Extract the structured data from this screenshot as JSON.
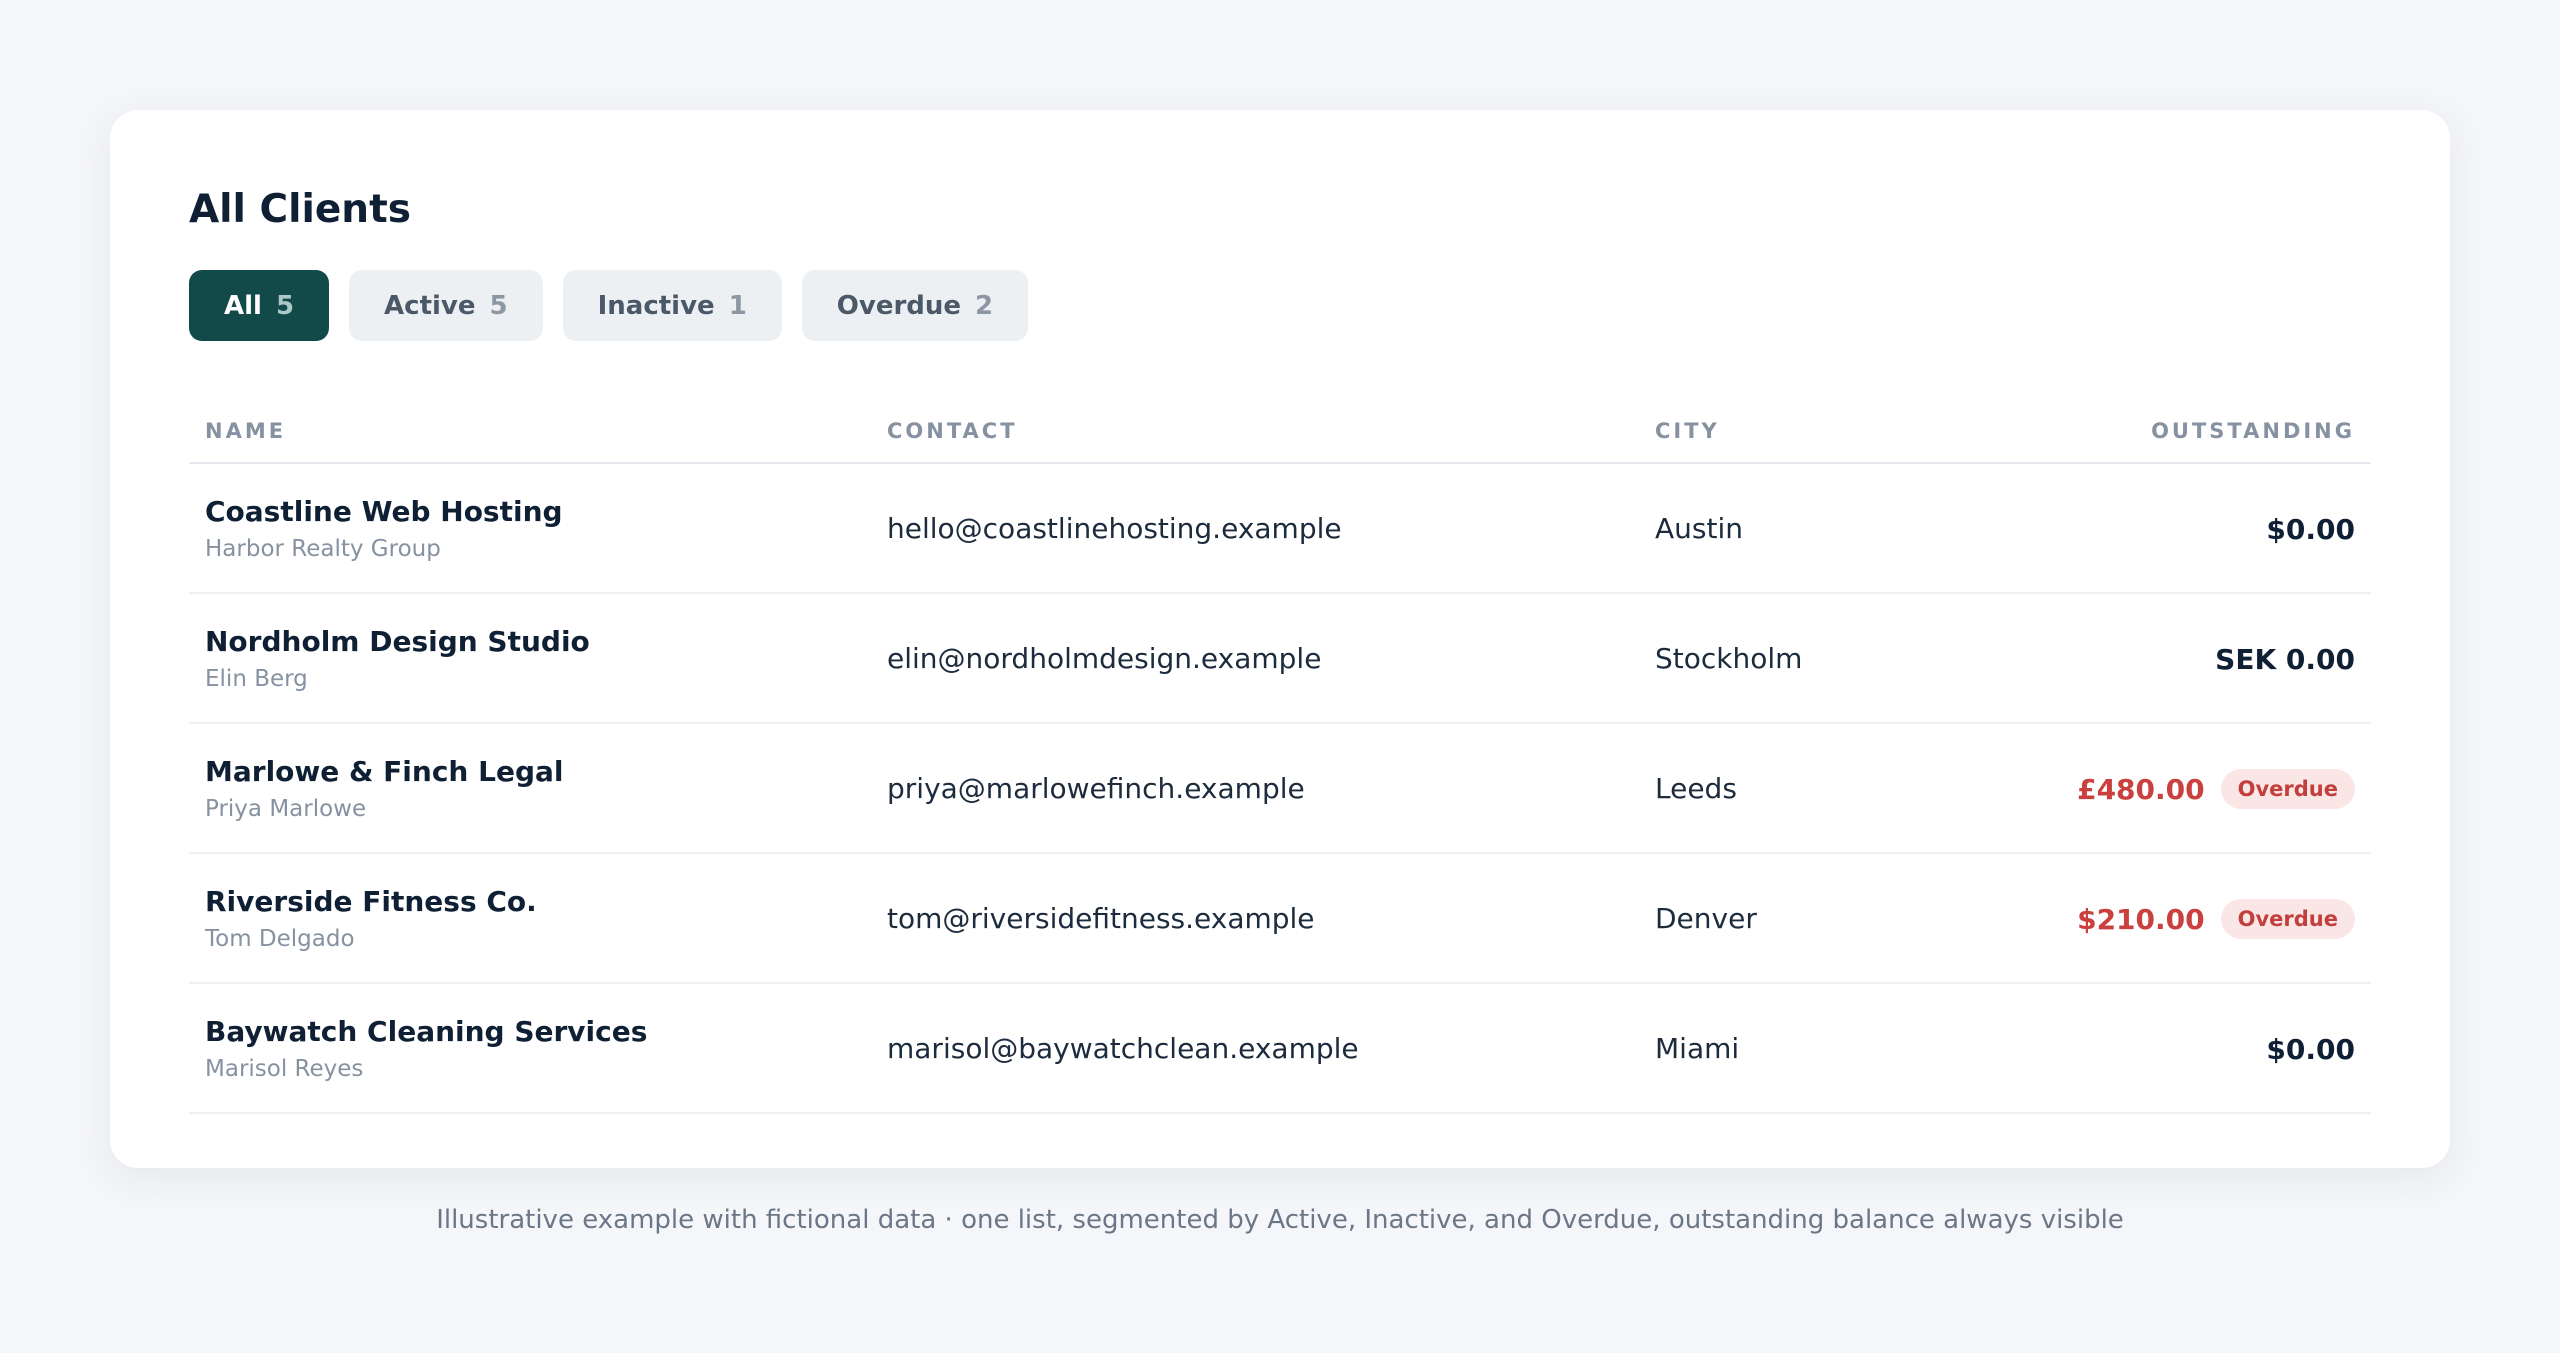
{
  "title": "All Clients",
  "tabs": [
    {
      "label": "All",
      "count": "5"
    },
    {
      "label": "Active",
      "count": "5"
    },
    {
      "label": "Inactive",
      "count": "1"
    },
    {
      "label": "Overdue",
      "count": "2"
    }
  ],
  "columns": {
    "name": "NAME",
    "contact": "CONTACT",
    "city": "CITY",
    "outstanding": "OUTSTANDING"
  },
  "rows": [
    {
      "name": "Coastline Web Hosting",
      "sub": "Harbor Realty Group",
      "contact": "hello@coastlinehosting.example",
      "city": "Austin",
      "amount": "$0.00"
    },
    {
      "name": "Nordholm Design Studio",
      "sub": "Elin Berg",
      "contact": "elin@nordholmdesign.example",
      "city": "Stockholm",
      "amount": "SEK 0.00"
    },
    {
      "name": "Marlowe & Finch Legal",
      "sub": "Priya Marlowe",
      "contact": "priya@marlowefinch.example",
      "city": "Leeds",
      "amount": "£480.00",
      "badge": "Overdue"
    },
    {
      "name": "Riverside Fitness Co.",
      "sub": "Tom Delgado",
      "contact": "tom@riversidefitness.example",
      "city": "Denver",
      "amount": "$210.00",
      "badge": "Overdue"
    },
    {
      "name": "Baywatch Cleaning Services",
      "sub": "Marisol Reyes",
      "contact": "marisol@baywatchclean.example",
      "city": "Miami",
      "amount": "$0.00"
    }
  ],
  "footnote": "Illustrative example with fictional data · one list, segmented by Active, Inactive, and Overdue, outstanding balance always visible",
  "colors": {
    "active_tab": "#124a4a",
    "overdue": "#c9403f",
    "badge_bg": "#fbe6e6"
  }
}
